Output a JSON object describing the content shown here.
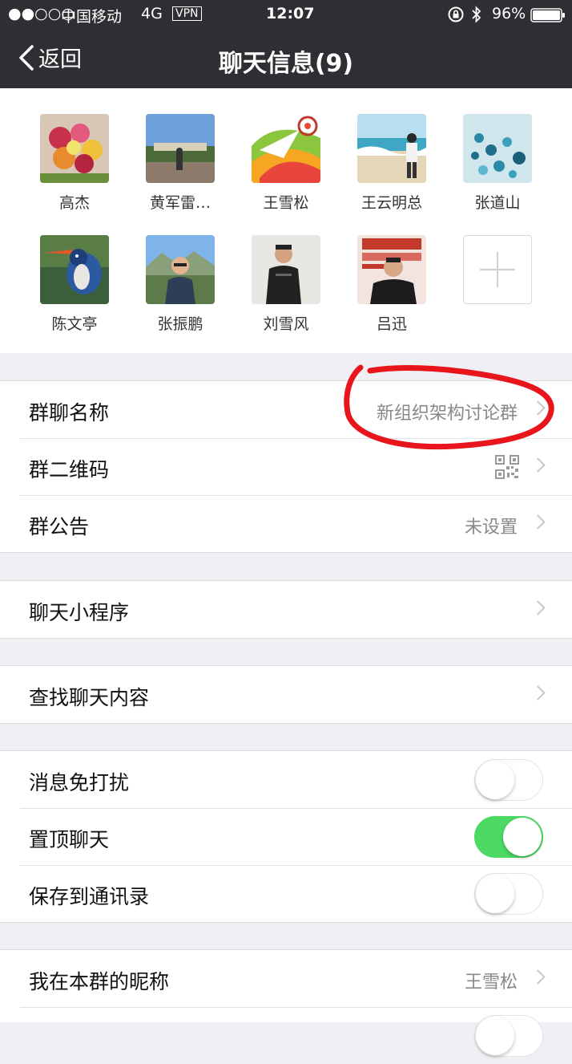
{
  "status_bar": {
    "signal": "●●○○○",
    "carrier": "中国移动",
    "network": "4G",
    "vpn": "VPN",
    "time": "12:07",
    "battery": "96%"
  },
  "nav": {
    "back_label": "返回",
    "title": "聊天信息(9)"
  },
  "members": [
    {
      "name": "高杰",
      "avatar_color": "#c2475a"
    },
    {
      "name": "黄军雷…",
      "avatar_color": "#5e8fc8"
    },
    {
      "name": "王雪松",
      "avatar_color": "#f3b13a"
    },
    {
      "name": "王云明总",
      "avatar_color": "#8ec8d8"
    },
    {
      "name": "张道山",
      "avatar_color": "#5fa5b8"
    },
    {
      "name": "陈文亭",
      "avatar_color": "#3c5a3a"
    },
    {
      "name": "张振鹏",
      "avatar_color": "#6b8fb5"
    },
    {
      "name": "刘雪风",
      "avatar_color": "#4a4a4a"
    },
    {
      "name": "吕迅",
      "avatar_color": "#c75b5b"
    }
  ],
  "settings": {
    "group_name": {
      "label": "群聊名称",
      "value": "新组织架构讨论群"
    },
    "group_qr": {
      "label": "群二维码"
    },
    "announcement": {
      "label": "群公告",
      "value": "未设置"
    },
    "mini_programs": {
      "label": "聊天小程序"
    },
    "search_content": {
      "label": "查找聊天内容"
    },
    "mute": {
      "label": "消息免打扰",
      "on": false
    },
    "pin_chat": {
      "label": "置顶聊天",
      "on": true
    },
    "save_contacts": {
      "label": "保存到通讯录",
      "on": false
    },
    "my_nickname": {
      "label": "我在本群的昵称",
      "value": "王雪松"
    }
  },
  "colors": {
    "annotation": "#e8161c",
    "toggle_on": "#4cd964",
    "nav_bg": "#2f2f33"
  }
}
